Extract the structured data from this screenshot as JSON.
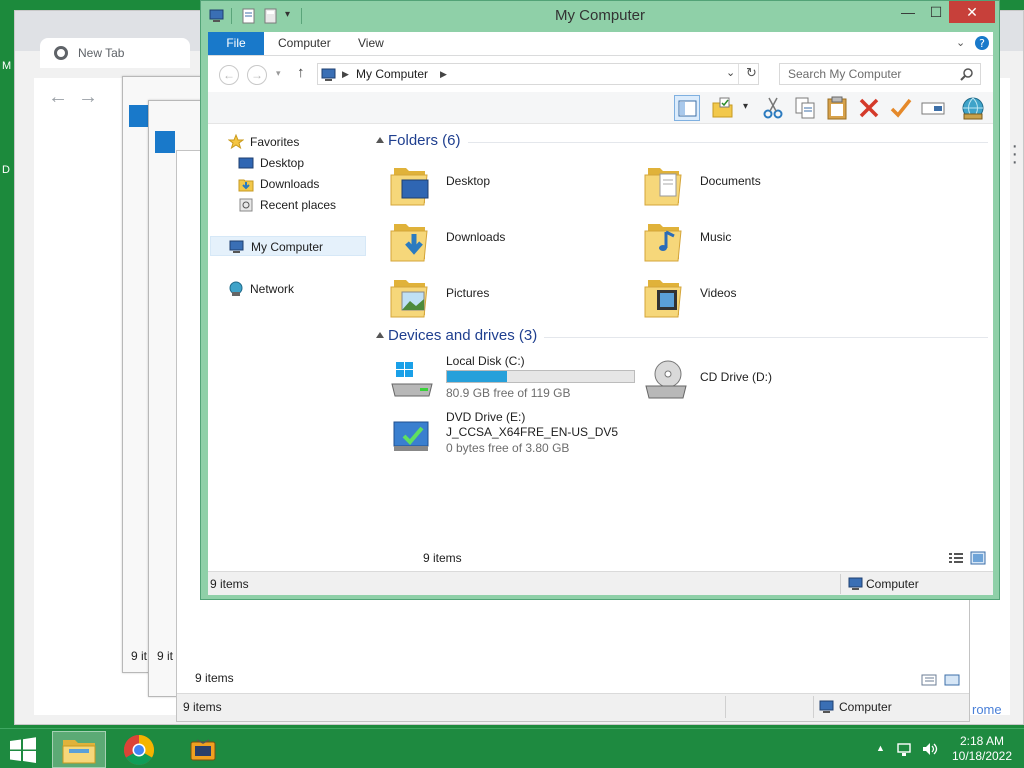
{
  "colors": {
    "desktop": "#1c8a3c",
    "frame": "#8fd0a8",
    "accent": "#1979ca",
    "close": "#c7403a",
    "progress": "#26a0da",
    "group_header": "#1f3f8f"
  },
  "desktop": {
    "edge_letters": [
      "M",
      "D"
    ],
    "chrome": {
      "tab_title": "New Tab",
      "brand_fragment": "rome"
    },
    "stack_windows": [
      {
        "status": "9 it"
      },
      {
        "status": "9 it"
      }
    ],
    "back_window": {
      "item_count": "9 items",
      "status_left": "9 items",
      "status_right": "Computer"
    }
  },
  "window": {
    "title": "My Computer",
    "controls": {
      "minimize": "—",
      "maximize": "☐",
      "close": "✕"
    },
    "ribbon": {
      "tabs": [
        "File",
        "Computer",
        "View"
      ],
      "help_icon": "help-icon"
    },
    "address": {
      "path": "My Computer",
      "search_placeholder": "Search My Computer"
    },
    "toolbar_icons": [
      "preview-pane-icon",
      "properties-icon",
      "cut-icon",
      "copy-icon",
      "paste-icon",
      "delete-icon",
      "check-icon",
      "rename-icon",
      "network-globe-icon"
    ],
    "nav": {
      "favorites_label": "Favorites",
      "favorites": [
        "Desktop",
        "Downloads",
        "Recent places"
      ],
      "computer": "My Computer",
      "network": "Network"
    },
    "folders_group": "Folders (6)",
    "folders": [
      "Desktop",
      "Documents",
      "Downloads",
      "Music",
      "Pictures",
      "Videos"
    ],
    "drives_group": "Devices and drives (3)",
    "drives": {
      "local": {
        "name": "Local Disk (C:)",
        "free": "80.9 GB free of 119 GB",
        "used_fraction": 0.32
      },
      "cd": {
        "name": "CD Drive (D:)"
      },
      "dvd": {
        "name": "DVD Drive (E:)",
        "label": "J_CCSA_X64FRE_EN-US_DV5",
        "free": "0 bytes free of 3.80 GB"
      }
    },
    "inner_status": "9 items",
    "status_left": "9 items",
    "status_right": "Computer"
  },
  "taskbar": {
    "time": "2:18 AM",
    "date": "10/18/2022"
  }
}
